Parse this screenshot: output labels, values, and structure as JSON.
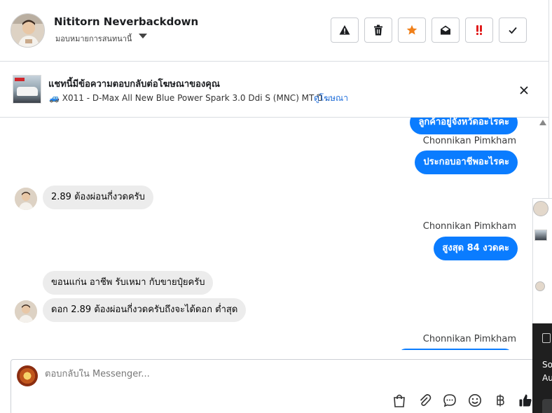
{
  "header": {
    "name": "Nititorn Neverbackdown",
    "assign_label": "มอบหมายการสนทนานี้"
  },
  "ad_banner": {
    "title": "แชทนี้มีข้อความตอบกลับต่อโฆษณาของคุณ",
    "description": "🚙 X011 - D-Max All New Blue Power Spark 3.0 Ddi S (MNC) MT ปี ...",
    "link": "ดูโฆษณา"
  },
  "messages": [
    {
      "type": "out",
      "text": "ลูกค้าอยู่จังหวัดอะไรคะ"
    },
    {
      "type": "sender",
      "text": "Chonnikan Pimkham"
    },
    {
      "type": "out",
      "text": "ประกอบอาชีพอะไรคะ"
    },
    {
      "type": "in",
      "text": "2.89 ต้องผ่อนกี่งวดครับ"
    },
    {
      "type": "sender",
      "text": "Chonnikan Pimkham"
    },
    {
      "type": "out",
      "text": "สูงสุด 84 งวดคะ"
    },
    {
      "type": "in",
      "text": "ขอนแก่น อาชีพ รับเหมา กับขายปุ๋ยครับ"
    },
    {
      "type": "in",
      "text": "ดอก 2.89 ต้องผ่อนกี่งวดครับถึงจะได้ดอก ต่ำสุด"
    },
    {
      "type": "sender",
      "text": "Chonnikan Pimkham"
    }
  ],
  "composer": {
    "placeholder": "ตอบกลับใน Messenger..."
  },
  "colors": {
    "outgoing_bubble": "#0a7cff",
    "incoming_bubble": "#ececec",
    "link": "#216fdb",
    "star": "#f0801a",
    "alert": "#e01b1b"
  },
  "icons": {
    "header_actions": [
      "warning-icon",
      "trash-icon",
      "star-icon",
      "envelope-open-icon",
      "double-exclamation-icon",
      "check-icon"
    ],
    "composer_tools": [
      "shopping-bag-icon",
      "paperclip-icon",
      "chat-bubble-icon",
      "emoji-icon",
      "baht-icon",
      "thumbs-up-icon"
    ]
  },
  "side_fragment": {
    "label_1": "So",
    "label_2": "Au"
  }
}
